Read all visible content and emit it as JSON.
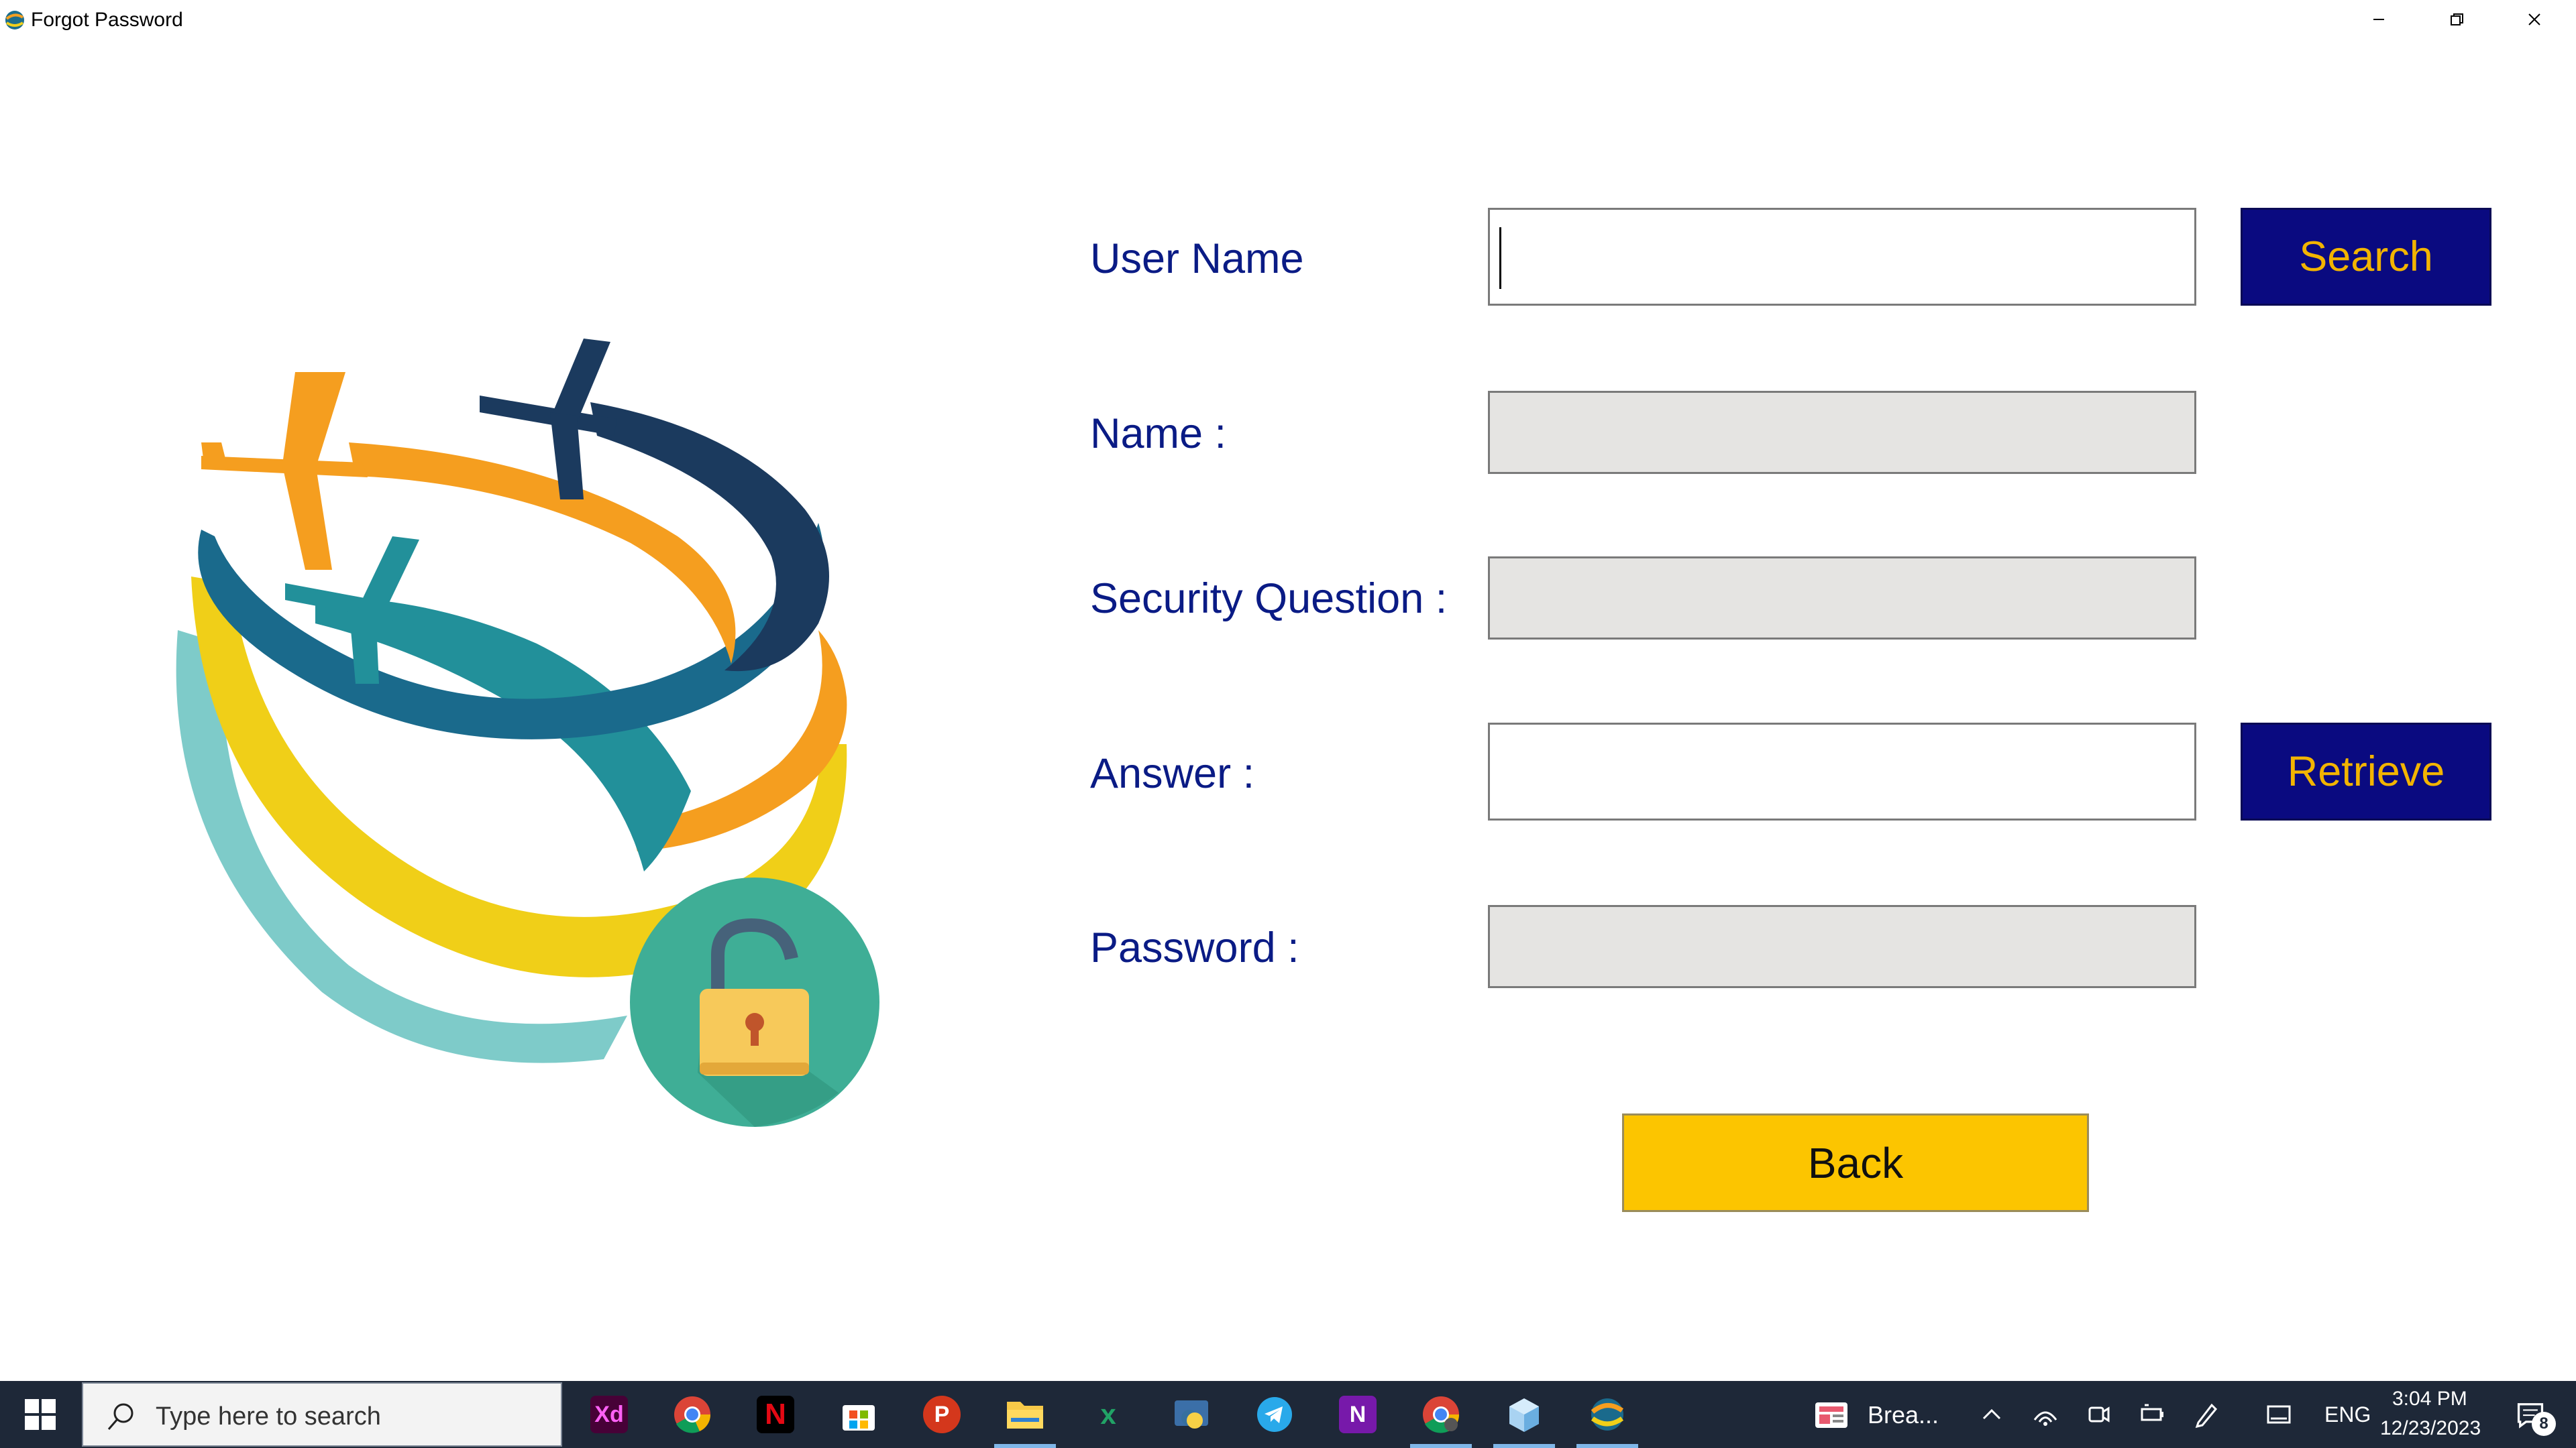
{
  "window": {
    "title": "Forgot Password",
    "controls": {
      "minimize": "minimize-icon",
      "restore": "restore-icon",
      "close": "close-icon"
    }
  },
  "form": {
    "username_label": "User Name",
    "name_label": "Name :",
    "question_label": "Security Question :",
    "answer_label": "Answer :",
    "password_label": "Password :",
    "username_value": "",
    "name_value": "",
    "question_value": "",
    "answer_value": "",
    "password_value": "",
    "search_label": "Search",
    "retrieve_label": "Retrieve",
    "back_label": "Back"
  },
  "logo": {
    "icons": [
      "airplane-icon",
      "globe-swirl-icon",
      "unlocked-padlock-icon"
    ]
  },
  "taskbar": {
    "search_placeholder": "Type here to search",
    "apps": [
      "adobe-xd-icon",
      "chrome-icon",
      "netflix-icon",
      "microsoft-store-icon",
      "app-p-icon",
      "file-explorer-icon",
      "excel-icon",
      "python-icon",
      "telegram-icon",
      "onenote-icon",
      "chrome-profile-icon",
      "cube-app-icon",
      "travel-app-icon"
    ],
    "pinned_window": "Brea...",
    "language": "ENG",
    "time": "3:04 PM",
    "date": "12/23/2023",
    "notification_count": "8"
  },
  "colors": {
    "label_text": "#0a1b85",
    "navy_button": "#0a0a80",
    "button_text": "#f2b400",
    "back_button": "#fcc500",
    "readonly_field": "#e5e4e2",
    "taskbar": "#1e2838"
  }
}
